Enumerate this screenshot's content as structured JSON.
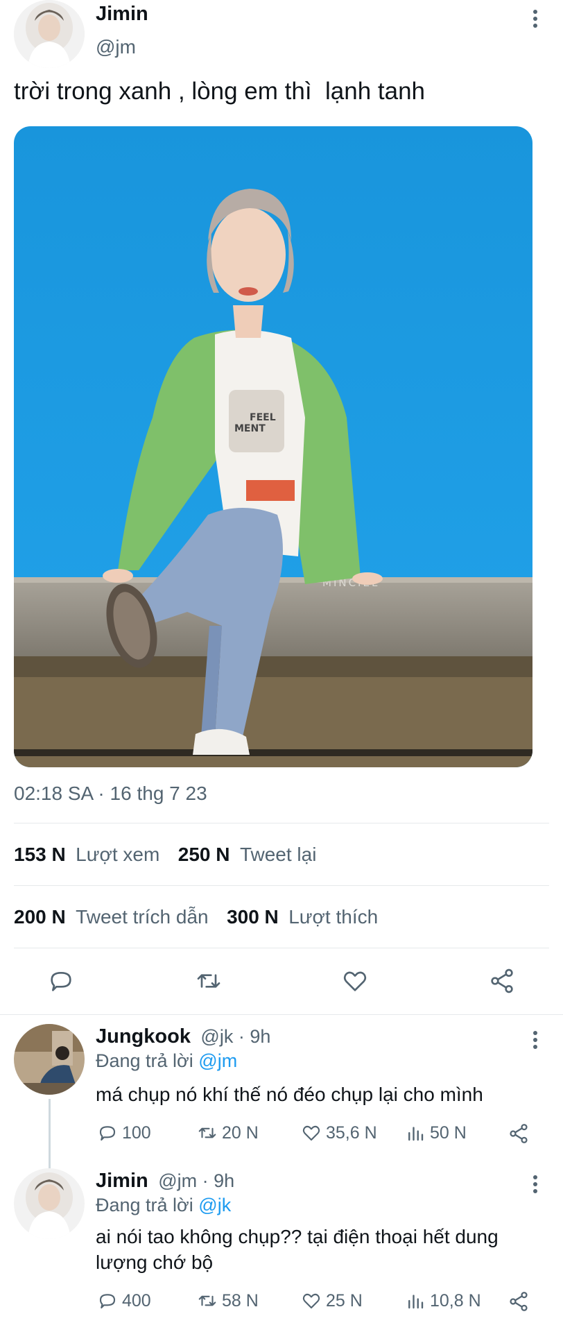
{
  "tweet": {
    "author_name": "Jimin",
    "author_handle": "@jm",
    "text": "trời trong xanh , lòng em thì  lạnh tanh",
    "photo_watermark": "MINCIEL",
    "shirt_print": "FEEL\nMENT",
    "timestamp": "02:18 SA · 16 thg 7 23",
    "stats": {
      "views_count": "153 N",
      "views_label": "Lượt xem",
      "retweets_count": "250 N",
      "retweets_label": "Tweet lại",
      "quotes_count": "200 N",
      "quotes_label": "Tweet trích dẫn",
      "likes_count": "300 N",
      "likes_label": "Lượt thích"
    }
  },
  "replies": [
    {
      "name": "Jungkook",
      "meta": "@jk · 9h",
      "replying_prefix": "Đang trả lời",
      "replying_to": "@jm",
      "text_lines": [
        "má chụp nó khí thế nó đéo chụp lại cho mình"
      ],
      "replies": "100",
      "retweets": "20 N",
      "likes": "35,6 N",
      "views": "50 N"
    },
    {
      "name": "Jimin",
      "meta": "@jm · 9h",
      "replying_prefix": "Đang trả lời",
      "replying_to": "@jk",
      "text_lines": [
        "ai nói tao không chụp?? tại điện thoại hết dung",
        "lượng chớ bộ"
      ],
      "replies": "400",
      "retweets": "58 N",
      "likes": "25 N",
      "views": "10,8 N"
    }
  ],
  "colors": {
    "accent": "#1d9bf0",
    "muted": "#536471",
    "sky": "#1a9ae0"
  }
}
